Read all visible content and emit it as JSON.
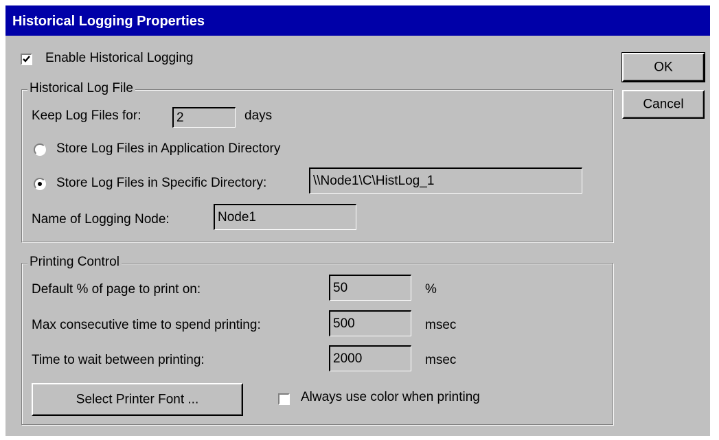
{
  "window": {
    "title": "Historical Logging Properties"
  },
  "enable": {
    "label": "Enable Historical Logging",
    "checked": true
  },
  "log_file": {
    "legend": "Historical Log File",
    "keep_label": "Keep Log Files for:",
    "keep_value": "2",
    "keep_unit": "days",
    "radio_app_label": "Store Log Files in Application Directory",
    "radio_specific_label": "Store Log Files in Specific Directory:",
    "selected": "specific",
    "directory_value": "\\\\Node1\\C\\HistLog_1",
    "node_label": "Name of Logging Node:",
    "node_value": "Node1"
  },
  "printing": {
    "legend": "Printing Control",
    "default_pct_label": "Default % of page to print on:",
    "default_pct_value": "50",
    "default_pct_unit": "%",
    "max_time_label": "Max consecutive time to spend printing:",
    "max_time_value": "500",
    "max_time_unit": "msec",
    "wait_label": "Time to wait between printing:",
    "wait_value": "2000",
    "wait_unit": "msec",
    "font_button": "Select Printer Font ...",
    "color_label": "Always use color when printing",
    "color_checked": false
  },
  "buttons": {
    "ok": "OK",
    "cancel": "Cancel"
  },
  "icons": {
    "checkbox_checked": "check-mark-icon",
    "radio_selected": "radio-dot-icon"
  }
}
